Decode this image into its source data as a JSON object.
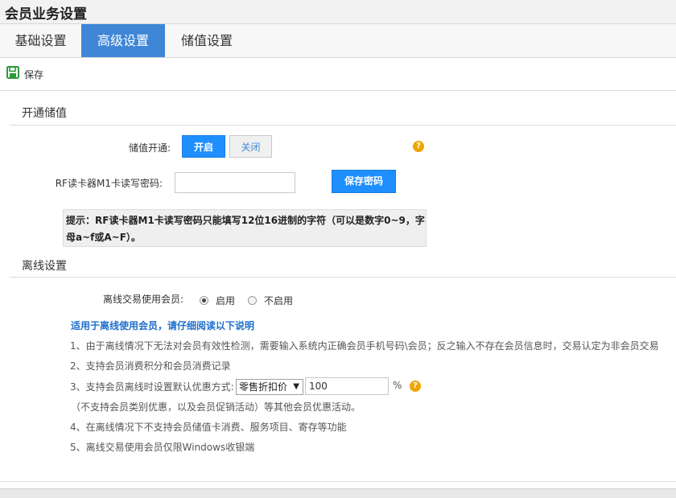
{
  "window": {
    "title": "会员业务设置"
  },
  "tabs": [
    {
      "label": "基础设置",
      "active": false
    },
    {
      "label": "高级设置",
      "active": true
    },
    {
      "label": "储值设置",
      "active": false
    }
  ],
  "toolbar": {
    "save_label": "保存",
    "save_icon": "floppy-disk-icon"
  },
  "stored_value": {
    "section_title": "开通储值",
    "open_label": "储值开通:",
    "on_label": "开启",
    "off_label": "关闭",
    "rf_label": "RF读卡器M1卡读写密码:",
    "rf_value": "",
    "save_password_label": "保存密码",
    "tip": "提示：RF读卡器M1卡读写密码只能填写12位16进制的字符（可以是数字0~9，字母a~f或A~F）。"
  },
  "offline": {
    "section_title": "离线设置",
    "use_member_label": "离线交易使用会员:",
    "enable_label": "启用",
    "disable_label": "不启用",
    "notes_title": "适用于离线使用会员，请仔细阅读以下说明",
    "note1": "1、由于离线情况下无法对会员有效性检测，需要输入系统内正确会员手机号码\\会员；反之输入不存在会员信息时，交易认定为非会员交易",
    "note2": "2、支持会员消费积分和会员消费记录",
    "note3_prefix": "3、支持会员离线时设置默认优惠方式:",
    "discount_select": "零售折扣价",
    "discount_value": "100",
    "percent": "%",
    "note3_sub": "（不支持会员类别优惠，以及会员促销活动）等其他会员优惠活动。",
    "note4": "4、在离线情况下不支持会员储值卡消费、服务项目、寄存等功能",
    "note5": "5、离线交易使用会员仅限Windows收银端"
  },
  "colors": {
    "accent": "#3f86d7",
    "button": "#1f8fff",
    "help": "#f0a500",
    "notes_title": "#1f6fcf"
  }
}
